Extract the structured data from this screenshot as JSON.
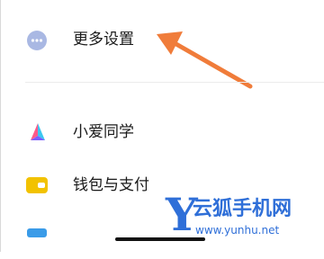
{
  "settings": {
    "items": [
      {
        "label": "更多设置",
        "icon": "more-icon"
      },
      {
        "label": "小爱同学",
        "icon": "xiaoai-icon"
      },
      {
        "label": "钱包与支付",
        "icon": "wallet-icon"
      }
    ]
  },
  "watermark": {
    "letter": "Y",
    "title": "云狐手机网",
    "url": "www.yunhu.net"
  },
  "colors": {
    "arrow": "#f07c3a",
    "more_icon": "#a9b8e3",
    "wallet_icon": "#f2c200",
    "watermark": "#2f6fd8"
  }
}
